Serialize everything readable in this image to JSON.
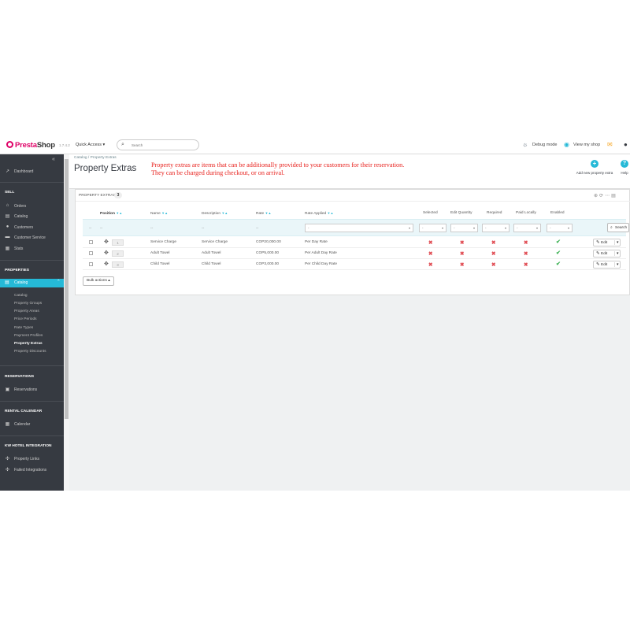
{
  "header": {
    "logo_prefix": "Presta",
    "logo_suffix": "Shop",
    "version": "1.7.4.2",
    "quick_access": "Quick Access",
    "search_placeholder": "Search",
    "debug_mode": "Debug mode",
    "view_shop": "View my shop"
  },
  "sidebar": {
    "dashboard": "Dashboard",
    "sell_heading": "SELL",
    "sell_items": [
      "Orders",
      "Catalog",
      "Customers",
      "Customer Service",
      "Stats"
    ],
    "properties_heading": "PROPERTIES",
    "active_item": "Catalog",
    "sub_items": [
      "Catalog",
      "Property Groups",
      "Property Areas",
      "Price Periods",
      "Rate Types",
      "Payment Profiles",
      "Property Extras",
      "Property Discounts"
    ],
    "current_sub": "Property Extras",
    "reservations_heading": "RESERVATIONS",
    "reservations_item": "Reservations",
    "rental_heading": "RENTAL CALENDAR",
    "calendar_item": "Calendar",
    "integration_heading": "KW HOTEL INTEGRATION",
    "integration_items": [
      "Property Links",
      "Failed Integrations"
    ]
  },
  "toolbar": {
    "breadcrumb_1": "Catalog",
    "breadcrumb_sep": "/",
    "breadcrumb_2": "Property Extras",
    "title": "Property Extras",
    "note_line1": "Property extras are items that can be additionally provided to your customers for their reservation.",
    "note_line2": "They can be charged during checkout, or on arrival.",
    "add_new": "Add new property extra",
    "help": "Help"
  },
  "panel": {
    "title": "PROPERTY EXTRAS",
    "count": "3"
  },
  "table": {
    "headers": {
      "position": "Position",
      "name": "Name",
      "description": "Description",
      "rate": "Rate",
      "rate_applied": "Rate Applied",
      "selected": "Selected",
      "edit_quantity": "Edit Quantity",
      "required": "Required",
      "paid_locally": "Paid Locally",
      "enabled": "Enabled"
    },
    "filter_dash": "--",
    "filter_select": "-",
    "search_label": "Search",
    "rows": [
      {
        "position": "1",
        "name": "Service Charge",
        "description": "Service Charge",
        "rate": "COP20,000.00",
        "rate_applied": "Per Day Rate"
      },
      {
        "position": "2",
        "name": "Adult Towel",
        "description": "Adult Towel",
        "rate": "COP5,000.00",
        "rate_applied": "Per Adult Day Rate"
      },
      {
        "position": "3",
        "name": "Child Towel",
        "description": "Child Towel",
        "rate": "COP3,000.00",
        "rate_applied": "Per Child Day Rate"
      }
    ],
    "edit_label": "Edit",
    "bulk_actions": "Bulk actions"
  }
}
